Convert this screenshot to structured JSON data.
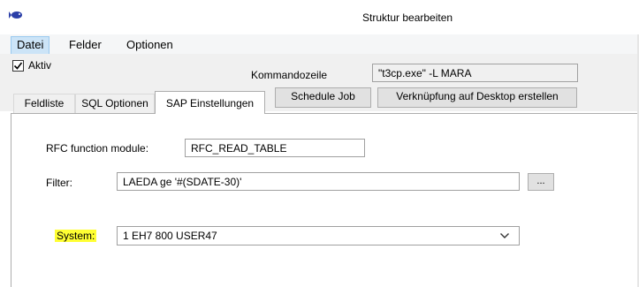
{
  "window": {
    "title": "Struktur bearbeiten",
    "icon": "fish-icon"
  },
  "menu": {
    "items": [
      {
        "label": "Datei",
        "active": true
      },
      {
        "label": "Felder"
      },
      {
        "label": "Optionen"
      }
    ]
  },
  "header": {
    "aktiv": {
      "label": "Aktiv",
      "checked": true
    },
    "kommandozeile": {
      "label": "Kommandozeile",
      "value": "\"t3cp.exe\" -L MARA"
    },
    "buttons": {
      "schedule": "Schedule Job",
      "desktop": "Verknüpfung auf Desktop erstellen"
    }
  },
  "tabs": [
    {
      "label": "Feldliste"
    },
    {
      "label": "SQL Optionen"
    },
    {
      "label": "SAP Einstellungen",
      "selected": true
    }
  ],
  "sap": {
    "rfc": {
      "label": "RFC function module:",
      "value": "RFC_READ_TABLE"
    },
    "filter": {
      "label": "Filter:",
      "value": "LAEDA ge '#(SDATE-30)'",
      "browse_label": "..."
    },
    "system": {
      "label": "System:",
      "value": "1 EH7 800 USER47",
      "highlight": "#ffff33"
    }
  }
}
